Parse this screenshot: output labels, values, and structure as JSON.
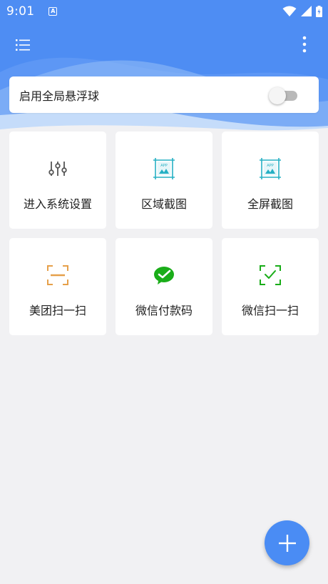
{
  "status_bar": {
    "time": "9:01",
    "notification_icon": "a-icon",
    "wifi_icon": "wifi-icon",
    "signal_icon": "signal-icon",
    "battery_icon": "battery-icon"
  },
  "header": {
    "menu_icon": "list-menu-icon",
    "more_icon": "more-vert-icon",
    "accent": "#4e8df3"
  },
  "float_ball": {
    "label": "启用全局悬浮球",
    "enabled": false
  },
  "tiles": [
    {
      "label": "进入系统设置",
      "icon": "sliders-icon",
      "color": "#555555"
    },
    {
      "label": "区域截图",
      "icon": "area-screenshot-icon",
      "color": "#26b0c4"
    },
    {
      "label": "全屏截图",
      "icon": "fullscreen-screenshot-icon",
      "color": "#26b0c4"
    },
    {
      "label": "美团扫一扫",
      "icon": "scan-icon",
      "color": "#e6a04a"
    },
    {
      "label": "微信付款码",
      "icon": "wechat-icon",
      "color": "#1aad19"
    },
    {
      "label": "微信扫一扫",
      "icon": "scan-check-icon",
      "color": "#1aad19"
    }
  ],
  "fab": {
    "icon": "plus-icon",
    "color": "#4a8cf4"
  }
}
